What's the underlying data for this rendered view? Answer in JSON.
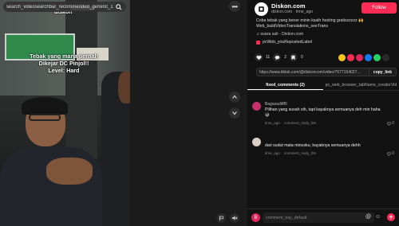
{
  "search": {
    "query": "search_videosearchbar_recommended_generic_1"
  },
  "video": {
    "caption": "Tebak yang mana pernah\nDikejar DC Pinjol!!\nLevel: Hard",
    "watermark": "diskon"
  },
  "nav": {
    "more_label": "•••"
  },
  "author": {
    "name": "Diskon.com",
    "meta": "diskon.com · time_ago",
    "follow_label": "Follow",
    "description": "Coba tebak yang bener minin kasih hosting gratiszzzzz 🙌 Web_buildVideoTranslations_seeTrans",
    "sound": "♫ suara asli - Diskon.com",
    "repost": "pcWeb_youRepostedLabel"
  },
  "actions": {
    "likes": "11",
    "comments": "2",
    "saves": "0"
  },
  "link": {
    "url": "https://www.tiktok.com/@diskoncom/video/7677154027...",
    "copy_label": "copy_link"
  },
  "tabs": [
    {
      "label": "fixed_comments (2)"
    },
    {
      "label": "pc_web_browser_tabName_creatorVid"
    }
  ],
  "comments": [
    {
      "user": "Bagasaditff0",
      "text": "Pilihan yang susah sih, tapi kayaknya semuanya deh min haha 😅",
      "time": "time_ago",
      "reply": "comment_reply_btn",
      "likes": "0"
    },
    {
      "user": "",
      "text": "dari sudut mata minusku, kayaknya semuanya dehh",
      "time": "time_ago",
      "reply": "comment_reply_btn",
      "likes": "0"
    }
  ],
  "comment_bar": {
    "placeholder": "comment_tray_default",
    "avatar_letter": "B"
  },
  "colors": {
    "accent": "#fe2c55",
    "panel": "#121212"
  }
}
